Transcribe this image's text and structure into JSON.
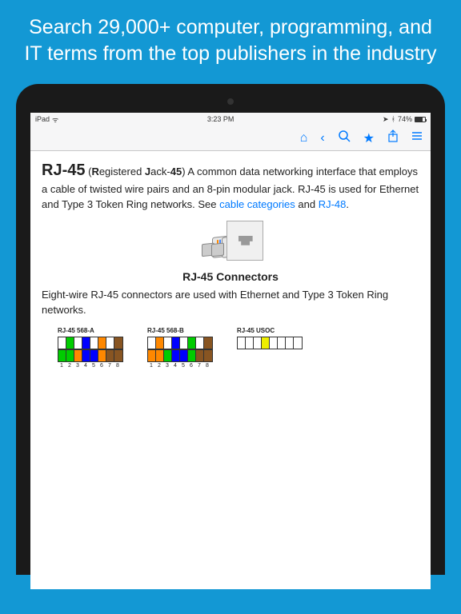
{
  "promo": "Search 29,000+ computer, programming, and IT terms from the top publishers in the industry",
  "status": {
    "carrier": "iPad",
    "wifi": "",
    "time": "3:23 PM",
    "battery": "74%"
  },
  "toolbar": {
    "home": "⌂",
    "back": "‹",
    "search": "🔍",
    "star": "★",
    "share": "⇪",
    "menu": "≡"
  },
  "article": {
    "term": "RJ-45",
    "def_prefix": " (",
    "def_bold1": "R",
    "def_mid1": "egistered ",
    "def_bold2": "J",
    "def_mid2": "ack-",
    "def_bold3": "45",
    "def_body": ") A common data networking interface that employs a cable of twisted wire pairs and an 8-pin modular jack. RJ-45 is used for Ethernet and Type 3 Token Ring networks. See ",
    "link1": "cable categories",
    "def_and": " and ",
    "link2": "RJ-48",
    "def_end": ".",
    "caption": "RJ-45 Connectors",
    "caption_body": "Eight-wire RJ-45 connectors are used with Ethernet and Type 3 Token Ring networks.",
    "pinouts": {
      "a": "RJ-45 568-A",
      "b": "RJ-45 568-B",
      "u": "RJ-45 USOC"
    }
  }
}
